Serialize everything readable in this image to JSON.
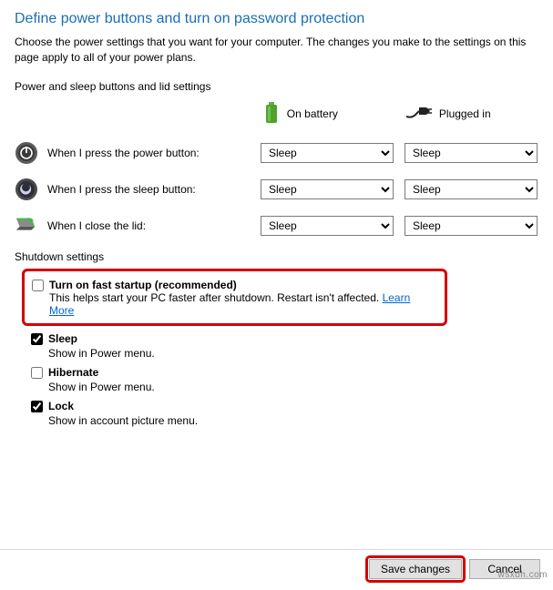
{
  "page": {
    "title": "Define power buttons and turn on password protection",
    "description": "Choose the power settings that you want for your computer. The changes you make to the settings on this page apply to all of your power plans.",
    "section_label": "Power and sleep buttons and lid settings"
  },
  "columns": {
    "battery": "On battery",
    "plugged": "Plugged in"
  },
  "rows": {
    "power_button": {
      "label": "When I press the power button:",
      "battery": "Sleep",
      "plugged": "Sleep"
    },
    "sleep_button": {
      "label": "When I press the sleep button:",
      "battery": "Sleep",
      "plugged": "Sleep"
    },
    "lid": {
      "label": "When I close the lid:",
      "battery": "Sleep",
      "plugged": "Sleep"
    }
  },
  "select_options": [
    "Sleep"
  ],
  "shutdown": {
    "title": "Shutdown settings",
    "fast_startup": {
      "checked": false,
      "label": "Turn on fast startup (recommended)",
      "sub": "This helps start your PC faster after shutdown. Restart isn't affected.",
      "link": "Learn More"
    },
    "sleep": {
      "checked": true,
      "label": "Sleep",
      "sub": "Show in Power menu."
    },
    "hibernate": {
      "checked": false,
      "label": "Hibernate",
      "sub": "Show in Power menu."
    },
    "lock": {
      "checked": true,
      "label": "Lock",
      "sub": "Show in account picture menu."
    }
  },
  "footer": {
    "save": "Save changes",
    "cancel": "Cancel"
  },
  "watermark": "wsxdh.com"
}
